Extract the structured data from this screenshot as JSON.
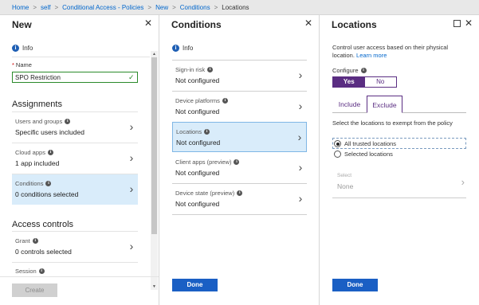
{
  "breadcrumb": {
    "items": [
      "Home",
      "self",
      "Conditional Access - Policies",
      "New",
      "Conditions",
      "Locations"
    ]
  },
  "new_blade": {
    "title": "New",
    "info": "Info",
    "name_label": "Name",
    "name_required_mark": "*",
    "name_value": "SPO Restriction",
    "assignments_title": "Assignments",
    "assignments": [
      {
        "label": "Users and groups",
        "value": "Specific users included"
      },
      {
        "label": "Cloud apps",
        "value": "1 app included"
      },
      {
        "label": "Conditions",
        "value": "0 conditions selected"
      }
    ],
    "access_controls_title": "Access controls",
    "access_controls": [
      {
        "label": "Grant",
        "value": "0 controls selected"
      },
      {
        "label": "Session",
        "value": ""
      }
    ],
    "create_label": "Create"
  },
  "conditions_blade": {
    "title": "Conditions",
    "info": "Info",
    "items": [
      {
        "label": "Sign-in risk",
        "value": "Not configured"
      },
      {
        "label": "Device platforms",
        "value": "Not configured"
      },
      {
        "label": "Locations",
        "value": "Not configured"
      },
      {
        "label": "Client apps (preview)",
        "value": "Not configured"
      },
      {
        "label": "Device state (preview)",
        "value": "Not configured"
      }
    ],
    "done_label": "Done"
  },
  "locations_blade": {
    "title": "Locations",
    "description": "Control user access based on their physical location.",
    "learn_more": "Learn more",
    "configure_label": "Configure",
    "toggle_yes": "Yes",
    "toggle_no": "No",
    "tabs": [
      "Include",
      "Exclude"
    ],
    "exempt_text": "Select the locations to exempt from the policy",
    "radio_options": [
      "All trusted locations",
      "Selected locations"
    ],
    "select_label": "Select",
    "select_value": "None",
    "done_label": "Done"
  },
  "icons": {
    "info": "info-icon",
    "close": "close-icon",
    "chevron": "chevron-right-icon",
    "maximize": "maximize-icon",
    "check": "check-icon"
  },
  "colors": {
    "accent_purple": "#5a2d82",
    "primary_blue": "#1a5fc4",
    "selected_bg": "#d9ecfa",
    "valid_green": "#2a8a2a"
  }
}
